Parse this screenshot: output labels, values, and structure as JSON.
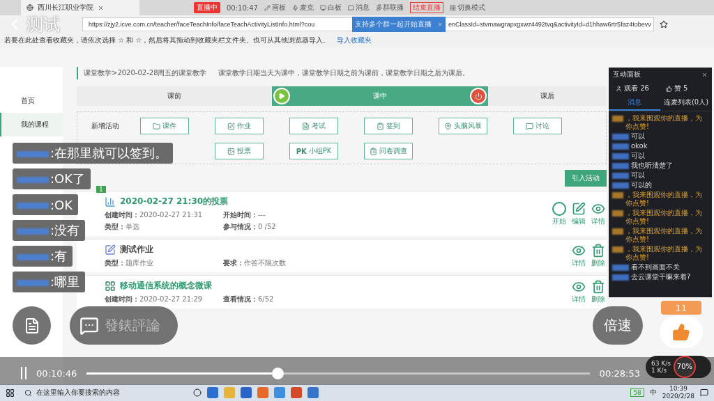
{
  "player": {
    "title": "测试",
    "danmaku": [
      {
        "text": ":在那里就可以签到。"
      },
      {
        "text": ":OK了"
      },
      {
        "text": ":OK"
      },
      {
        "text": ":没有"
      },
      {
        "text": ":有"
      },
      {
        "text": ":哪里"
      }
    ],
    "comment_button": "發錶評論",
    "speed_button": "倍速",
    "likes": "11",
    "elapsed": "00:10:46",
    "total": "00:28:53",
    "progress": {
      "level": 0.38
    }
  },
  "browser": {
    "tab": "西川长江职业学院",
    "url": "https://zjy2.icve.com.cn/teacher/faceTeachInfo/faceTeachActivityListInfo.html?cou",
    "url_tail": "enClassId=stvmawgrapxgxwz4492tvq&activityId=d1hhaw6rtr5faz4tobevv",
    "favorites_hint": "若要在此处查看收藏夹，请依次选择 ☆ 和 ☆，然后将其拖动到收藏夹栏文件夹。也可从其他浏览器导入。",
    "favorites_link": "导入收藏夹"
  },
  "live_toolbar": {
    "status": "直播中",
    "time": "00:10:47",
    "items": [
      {
        "kind": "pen",
        "label": "画板"
      },
      {
        "kind": "mic",
        "label": "麦克"
      },
      {
        "kind": "board",
        "label": "白板"
      },
      {
        "kind": "chat",
        "label": "消息"
      },
      {
        "kind": "text",
        "label": "多群联播"
      },
      {
        "kind": "end",
        "label": "结束直播"
      },
      {
        "kind": "grid",
        "label": "切换模式"
      }
    ]
  },
  "tooltip": {
    "text": "支持多个群一起开始直播"
  },
  "sidebar": [
    {
      "label": "首页",
      "selected": false
    },
    {
      "label": "我的课程",
      "selected": true
    }
  ],
  "breadcrumb": "课堂教学>2020-02-28周五的课堂教学",
  "note": "课堂教学日期当天为课中，课堂教学日期之前为课前，课堂教学日期之后为课后。",
  "stages": [
    {
      "label": "课前",
      "selected": false
    },
    {
      "label": "课中",
      "selected": true
    },
    {
      "label": "课后",
      "selected": false
    }
  ],
  "add_activity": {
    "label": "新增活动",
    "row_1": [
      {
        "kind": "folder",
        "label": "课件"
      },
      {
        "kind": "edit",
        "label": "作业"
      },
      {
        "kind": "exam",
        "label": "考试"
      },
      {
        "kind": "checkin",
        "label": "签到"
      },
      {
        "kind": "pin",
        "label": "头脑风暴"
      },
      {
        "kind": "discuss",
        "label": "讨论"
      }
    ],
    "row_2": [
      {
        "kind": "vote",
        "label": "投票"
      },
      {
        "kind": "pk",
        "label": "小组PK",
        "prefix": "PK"
      },
      {
        "kind": "survey",
        "label": "问卷调查"
      }
    ]
  },
  "import_button": "引入活动",
  "activities": [
    {
      "kind": "vote",
      "badge": "1",
      "title": "2020-02-27 21:30的投票",
      "fields": [
        [
          "创建时间：",
          "2020-02-27 21:31"
        ],
        [
          "开始时间：",
          "---"
        ],
        [
          "类型：",
          "单选"
        ],
        [
          "参与情况：",
          "0 /52"
        ]
      ],
      "actions": [
        {
          "kind": "start",
          "label": "开始"
        },
        {
          "kind": "edit",
          "label": "编辑"
        },
        {
          "kind": "view",
          "label": "详情"
        }
      ]
    },
    {
      "kind": "homework",
      "title": "测试作业",
      "fields": [
        [
          "类型：",
          "题库作业"
        ],
        [
          "要求：",
          "作答不限次数"
        ]
      ],
      "actions": [
        {
          "kind": "view",
          "label": "详情"
        },
        {
          "kind": "delete",
          "label": "删除"
        }
      ]
    },
    {
      "kind": "micro",
      "title": "移动通信系统的概念微课",
      "fields": [
        [
          "创建时间：",
          "2020-02-27 21:29"
        ],
        [
          "查看情况：",
          "6/52"
        ]
      ],
      "actions": [
        {
          "kind": "view",
          "label": "详情"
        },
        {
          "kind": "delete",
          "label": "删除"
        }
      ]
    }
  ],
  "chat": {
    "title": "互动面板",
    "viewers": "观看 26",
    "likes": "赞 5",
    "tabs": [
      {
        "label": "消息",
        "selected": true
      },
      {
        "label": "连麦列表(0人)",
        "selected": false
      }
    ],
    "messages": [
      {
        "kind": "system",
        "text": "，我来围观你的直播，为你点赞!"
      },
      {
        "kind": "user",
        "text": "可以"
      },
      {
        "kind": "user",
        "text": "okok"
      },
      {
        "kind": "user",
        "text": "可以"
      },
      {
        "kind": "user",
        "text": "我也听清楚了"
      },
      {
        "kind": "user",
        "text": "可以"
      },
      {
        "kind": "user",
        "text": "可以的"
      },
      {
        "kind": "system",
        "text": "，我来围观你的直播，为你点赞!"
      },
      {
        "kind": "system",
        "text": "，我来围观你的直播，为你点赞!"
      },
      {
        "kind": "system",
        "text": "，我来围观你的直播，为你点赞!"
      },
      {
        "kind": "system",
        "text": "，我来围观你的直播，为你点赞!"
      },
      {
        "kind": "user",
        "text": "看不到画面不关"
      },
      {
        "kind": "user",
        "text": "去云课堂干嘛来着?"
      }
    ]
  },
  "taskbar": {
    "search": "在这里输入你要搜索的内容",
    "battery": "58",
    "ime": "中",
    "time": "10:39",
    "date": "2020/2/28"
  },
  "net_widget": {
    "up": "63 K/s",
    "down": "1 K/s",
    "cpu": "70%"
  }
}
